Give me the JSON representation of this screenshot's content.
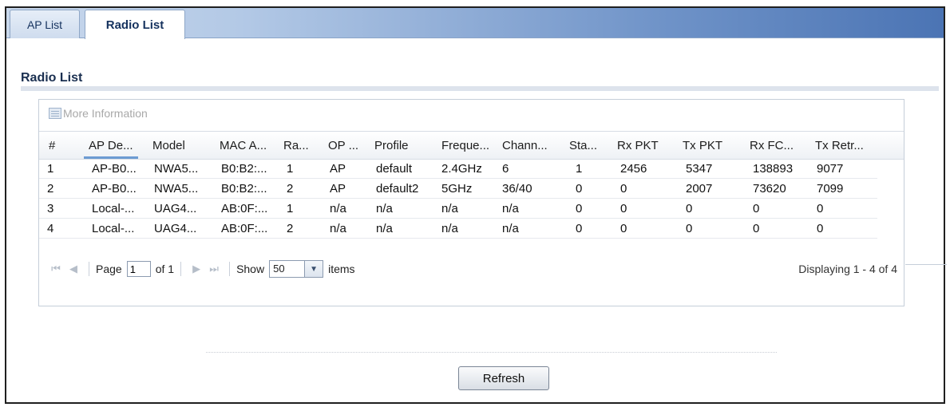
{
  "tabs": [
    {
      "label": "AP List",
      "active": false
    },
    {
      "label": "Radio List",
      "active": true
    }
  ],
  "section_title": "Radio List",
  "toolbar": {
    "more_info_label": "More Information"
  },
  "table": {
    "columns": [
      "#",
      "AP De...",
      "Model",
      "MAC A...",
      "Ra...",
      "OP ...",
      "Profile",
      "Freque...",
      "Chann...",
      "Sta...",
      "Rx PKT",
      "Tx PKT",
      "Rx FC...",
      "Tx Retr..."
    ],
    "rows": [
      [
        "1",
        "AP-B0...",
        "NWA5...",
        "B0:B2:...",
        "1",
        "AP",
        "default",
        "2.4GHz",
        "6",
        "1",
        "2456",
        "5347",
        "138893",
        "9077"
      ],
      [
        "2",
        "AP-B0...",
        "NWA5...",
        "B0:B2:...",
        "2",
        "AP",
        "default2",
        "5GHz",
        "36/40",
        "0",
        "0",
        "2007",
        "73620",
        "7099"
      ],
      [
        "3",
        "Local-...",
        "UAG4...",
        "AB:0F:...",
        "1",
        "n/a",
        "n/a",
        "n/a",
        "n/a",
        "0",
        "0",
        "0",
        "0",
        "0"
      ],
      [
        "4",
        "Local-...",
        "UAG4...",
        "AB:0F:...",
        "2",
        "n/a",
        "n/a",
        "n/a",
        "n/a",
        "0",
        "0",
        "0",
        "0",
        "0"
      ]
    ]
  },
  "pager": {
    "page_label": "Page",
    "page_value": "1",
    "of_label": "of 1",
    "show_label": "Show",
    "show_value": "50",
    "items_label": "items",
    "displaying": "Displaying 1 - 4 of 4"
  },
  "refresh_label": "Refresh",
  "colors": {
    "tab_gradient_end": "#4b74b4",
    "sort_indicator": "#6c9bd2"
  }
}
